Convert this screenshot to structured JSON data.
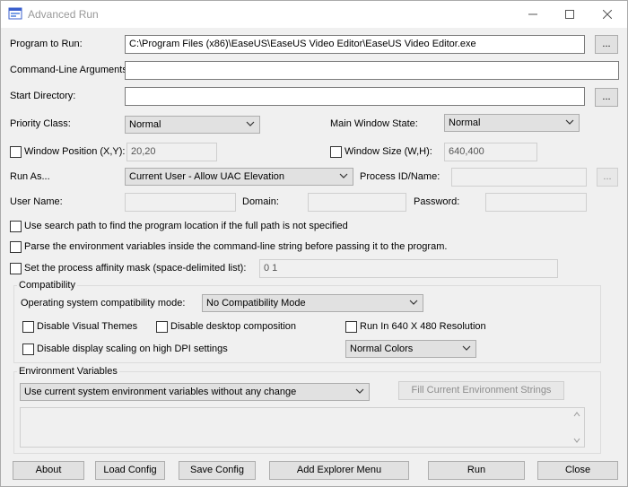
{
  "window": {
    "title": "Advanced Run",
    "controls": [
      "minimize",
      "maximize",
      "close"
    ]
  },
  "program": {
    "label": "Program to Run:",
    "value": "C:\\Program Files (x86)\\EaseUS\\EaseUS Video Editor\\EaseUS Video Editor.exe",
    "browse": "..."
  },
  "cmdline": {
    "label": "Command-Line Arguments:",
    "value": ""
  },
  "startdir": {
    "label": "Start Directory:",
    "value": "",
    "browse": "..."
  },
  "priority": {
    "label": "Priority Class:",
    "value": "Normal"
  },
  "mainwin": {
    "label": "Main Window State:",
    "value": "Normal"
  },
  "winpos": {
    "label": "Window Position (X,Y):",
    "value": "20,20",
    "checked": false
  },
  "winsize": {
    "label": "Window Size (W,H):",
    "value": "640,400",
    "checked": false
  },
  "runas": {
    "label": "Run As...",
    "value": "Current User - Allow UAC Elevation"
  },
  "pid": {
    "label": "Process ID/Name:",
    "value": "",
    "browse": "..."
  },
  "user": {
    "username_label": "User Name:",
    "domain_label": "Domain:",
    "password_label": "Password:"
  },
  "options": {
    "search_path": "Use search path to find the program location if the full path is not specified",
    "parse_env": "Parse the environment variables inside the command-line string before passing it to the program.",
    "affinity": "Set the process affinity mask (space-delimited list):",
    "affinity_value": "0 1"
  },
  "compat": {
    "group_label": "Compatibility",
    "mode_label": "Operating system compatibility mode:",
    "mode_value": "No Compatibility Mode",
    "disable_themes": "Disable Visual Themes",
    "disable_desktop": "Disable desktop composition",
    "run_640": "Run In 640 X 480 Resolution",
    "disable_dpi": "Disable display scaling on high DPI settings",
    "colors_value": "Normal Colors"
  },
  "env": {
    "group_label": "Environment Variables",
    "mode_value": "Use current system environment variables without any change",
    "fill_button": "Fill Current Environment Strings"
  },
  "buttons": {
    "about": "About",
    "load": "Load Config",
    "save": "Save Config",
    "explorer": "Add Explorer Menu",
    "run": "Run",
    "close": "Close"
  },
  "colors": {
    "window_bg": "#f0f0f0",
    "button_bg": "#e1e1e1",
    "border": "#adadad",
    "title_text": "#999999"
  }
}
